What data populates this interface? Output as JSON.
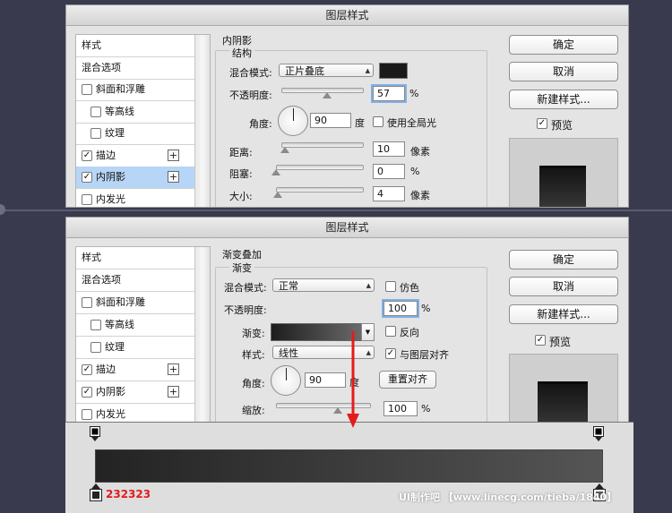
{
  "colors": {
    "accent_arrow": "#e31b1b",
    "stop_label": "#e31b1b",
    "selection": "#b7d6f7"
  },
  "top": {
    "title": "图层样式",
    "sidebar": [
      {
        "label": "样式",
        "checkbox": false,
        "checked": false,
        "plus": false,
        "selected": false,
        "indent": false
      },
      {
        "label": "混合选项",
        "checkbox": false,
        "checked": false,
        "plus": false,
        "selected": false,
        "indent": false
      },
      {
        "label": "斜面和浮雕",
        "checkbox": true,
        "checked": false,
        "plus": false,
        "selected": false,
        "indent": false
      },
      {
        "label": "等高线",
        "checkbox": true,
        "checked": false,
        "plus": false,
        "selected": false,
        "indent": true
      },
      {
        "label": "纹理",
        "checkbox": true,
        "checked": false,
        "plus": false,
        "selected": false,
        "indent": true
      },
      {
        "label": "描边",
        "checkbox": true,
        "checked": true,
        "plus": true,
        "selected": false,
        "indent": false
      },
      {
        "label": "内阴影",
        "checkbox": true,
        "checked": true,
        "plus": true,
        "selected": true,
        "indent": false
      },
      {
        "label": "内发光",
        "checkbox": true,
        "checked": false,
        "plus": false,
        "selected": false,
        "indent": false
      }
    ],
    "section": "内阴影",
    "group": "结构",
    "blend_label": "混合模式:",
    "blend_value": "正片叠底",
    "opacity_label": "不透明度:",
    "opacity_value": "57",
    "opacity_slider": 57,
    "percent": "%",
    "angle_label": "角度:",
    "angle_value": "90",
    "degree": "度",
    "global_light": "使用全局光",
    "distance_label": "距离:",
    "distance_value": "10",
    "distance_slider": 10,
    "choke_label": "阻塞:",
    "choke_value": "0",
    "choke_slider": 0,
    "size_label": "大小:",
    "size_value": "4",
    "size_slider": 4,
    "pixels": "像素",
    "ok": "确定",
    "cancel": "取消",
    "new_style": "新建样式...",
    "preview": "预览",
    "preview_checked": true
  },
  "bottom": {
    "title": "图层样式",
    "sidebar": [
      {
        "label": "样式",
        "checkbox": false,
        "checked": false,
        "plus": false,
        "selected": false,
        "indent": false
      },
      {
        "label": "混合选项",
        "checkbox": false,
        "checked": false,
        "plus": false,
        "selected": false,
        "indent": false
      },
      {
        "label": "斜面和浮雕",
        "checkbox": true,
        "checked": false,
        "plus": false,
        "selected": false,
        "indent": false
      },
      {
        "label": "等高线",
        "checkbox": true,
        "checked": false,
        "plus": false,
        "selected": false,
        "indent": true
      },
      {
        "label": "纹理",
        "checkbox": true,
        "checked": false,
        "plus": false,
        "selected": false,
        "indent": true
      },
      {
        "label": "描边",
        "checkbox": true,
        "checked": true,
        "plus": true,
        "selected": false,
        "indent": false
      },
      {
        "label": "内阴影",
        "checkbox": true,
        "checked": true,
        "plus": true,
        "selected": false,
        "indent": false
      },
      {
        "label": "内发光",
        "checkbox": true,
        "checked": false,
        "plus": false,
        "selected": false,
        "indent": false
      }
    ],
    "section": "渐变叠加",
    "group": "渐变",
    "blend_label": "混合模式:",
    "blend_value": "正常",
    "dither": "仿色",
    "opacity_label": "不透明度:",
    "opacity_value": "100",
    "percent": "%",
    "gradient_label": "渐变:",
    "reverse": "反向",
    "style_label": "样式:",
    "style_value": "线性",
    "align_layer": "与图层对齐",
    "angle_label": "角度:",
    "angle_value": "90",
    "degree": "度",
    "reset_align": "重置对齐",
    "scale_label": "缩放:",
    "scale_value": "100",
    "scale_slider": 100,
    "ok": "确定",
    "cancel": "取消",
    "new_style": "新建样式...",
    "preview": "预览",
    "preview_checked": true
  },
  "gradient_editor": {
    "left_color": "#232323",
    "right_color": "#555555",
    "left_stop_label": "232323",
    "watermark": "UI制作吧 【www.linecg.com/tieba/1840】"
  }
}
